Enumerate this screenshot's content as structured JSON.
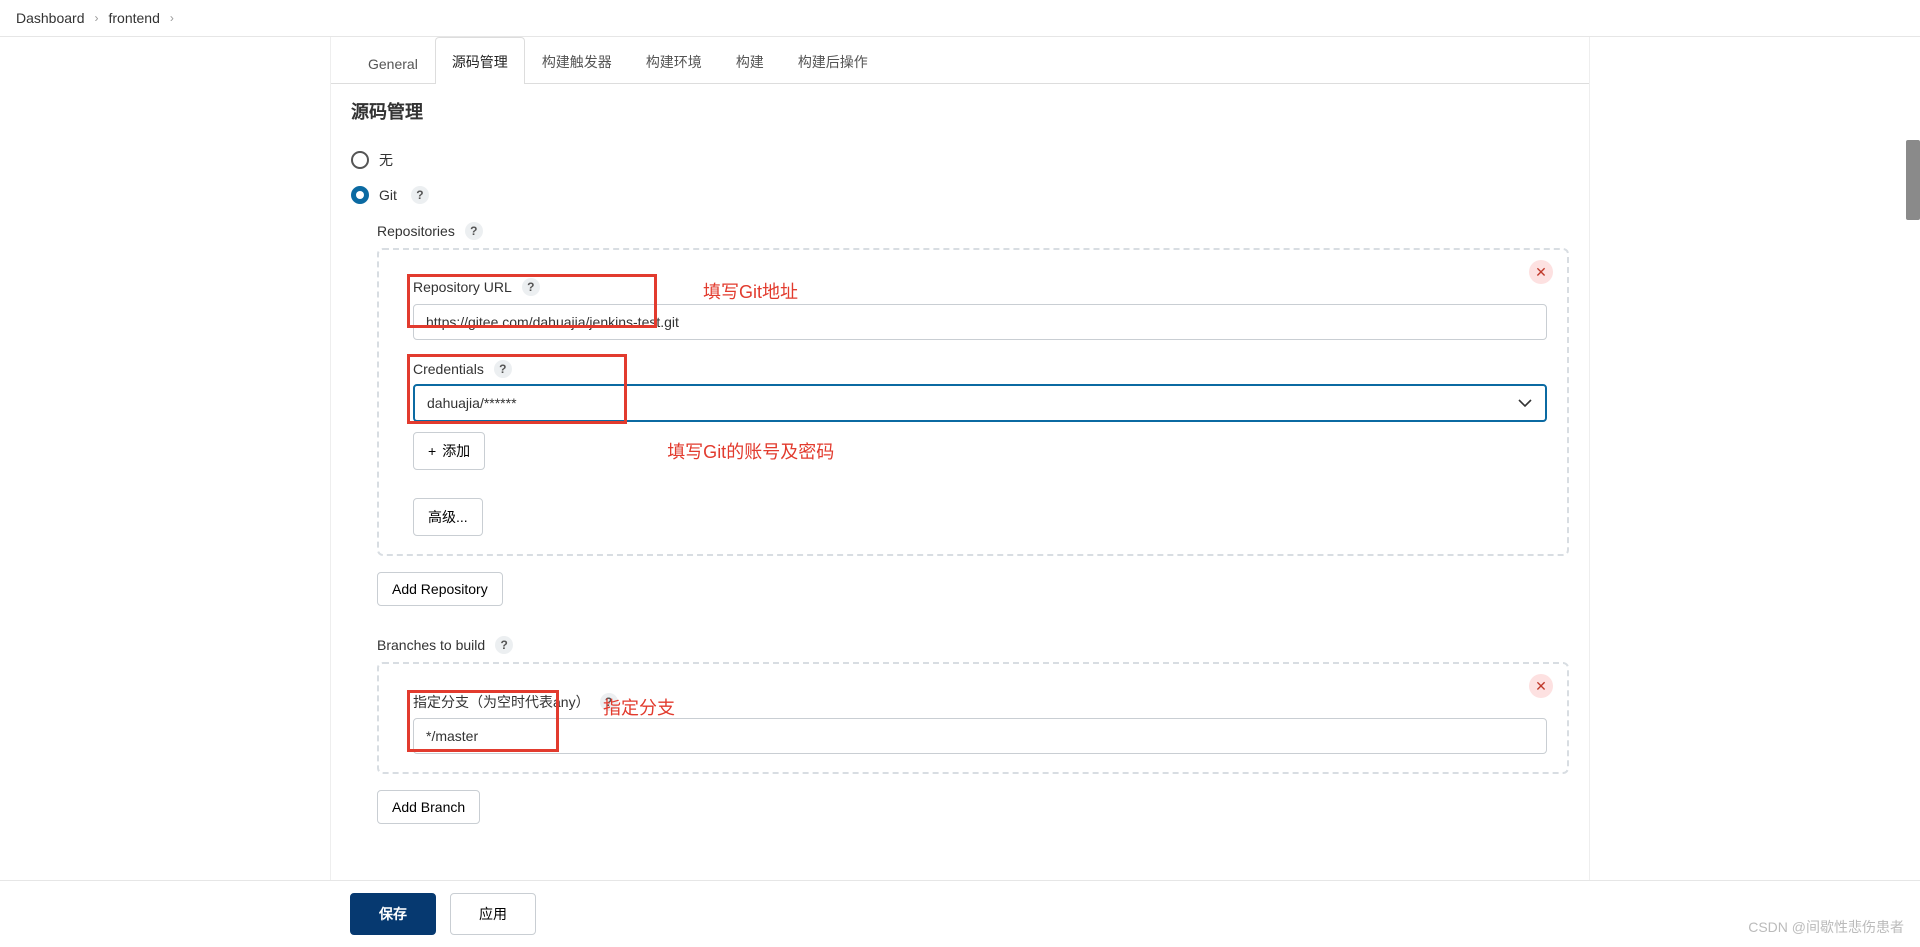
{
  "breadcrumb": [
    "Dashboard",
    "frontend"
  ],
  "tabs": [
    {
      "key": "general",
      "label": "General"
    },
    {
      "key": "scm",
      "label": "源码管理"
    },
    {
      "key": "triggers",
      "label": "构建触发器"
    },
    {
      "key": "env",
      "label": "构建环境"
    },
    {
      "key": "build",
      "label": "构建"
    },
    {
      "key": "post",
      "label": "构建后操作"
    }
  ],
  "active_tab": "源码管理",
  "section_title": "源码管理",
  "scm": {
    "none_label": "无",
    "git_label": "Git",
    "selected": "git",
    "repositories_label": "Repositories",
    "repo_url_label": "Repository URL",
    "repo_url_value": "https://gitee.com/dahuajia/jenkins-test.git",
    "credentials_label": "Credentials",
    "credentials_value": "dahuajia/******",
    "add_label": "添加",
    "advanced_label": "高级...",
    "add_repo_label": "Add Repository",
    "branches_label": "Branches to build",
    "branch_spec_label": "指定分支（为空时代表any）",
    "branch_spec_value": "*/master",
    "add_branch_label": "Add Branch"
  },
  "annotations": {
    "url_hint": "填写Git地址",
    "cred_hint": "填写Git的账号及密码",
    "branch_hint": "指定分支"
  },
  "footer": {
    "save": "保存",
    "apply": "应用"
  },
  "watermark": "CSDN @间歇性悲伤患者",
  "help_char": "?",
  "plus_char": "+"
}
